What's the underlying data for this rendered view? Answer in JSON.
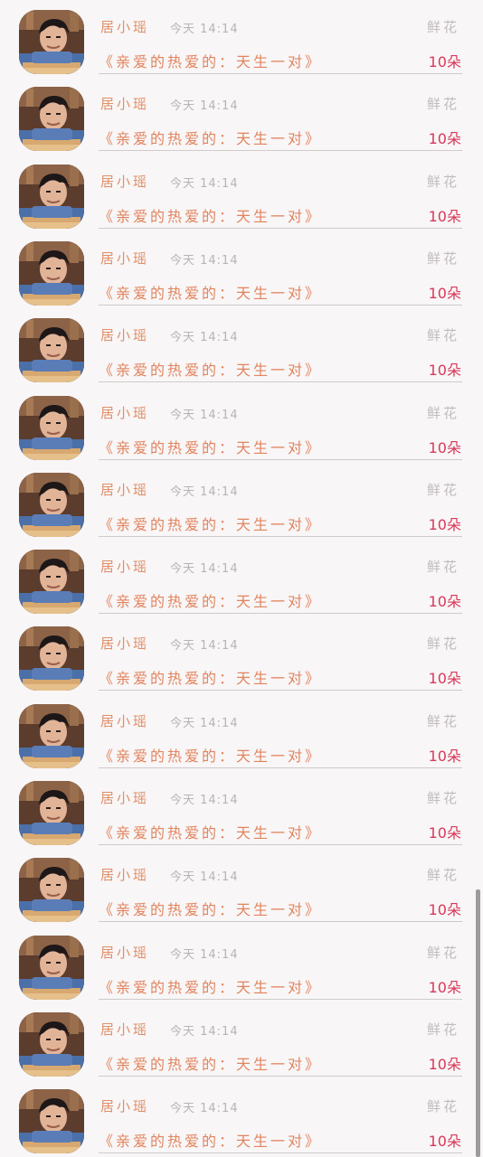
{
  "colors": {
    "background": "#f8f6f7",
    "name": "#e08f68",
    "time": "#b9b4b4",
    "gift": "#c2bcbc",
    "message": "#e2845e",
    "count": "#d8385a",
    "divider": "#cfcbcb"
  },
  "rows": [
    {
      "name": "居小瑶",
      "time": "今天 14:14",
      "gift": "鲜花",
      "message": "《亲爱的热爱的：天生一对》",
      "count": "10朵",
      "avatar": "avatar-photo"
    },
    {
      "name": "居小瑶",
      "time": "今天 14:14",
      "gift": "鲜花",
      "message": "《亲爱的热爱的：天生一对》",
      "count": "10朵",
      "avatar": "avatar-photo"
    },
    {
      "name": "居小瑶",
      "time": "今天 14:14",
      "gift": "鲜花",
      "message": "《亲爱的热爱的：天生一对》",
      "count": "10朵",
      "avatar": "avatar-photo"
    },
    {
      "name": "居小瑶",
      "time": "今天 14:14",
      "gift": "鲜花",
      "message": "《亲爱的热爱的：天生一对》",
      "count": "10朵",
      "avatar": "avatar-photo"
    },
    {
      "name": "居小瑶",
      "time": "今天 14:14",
      "gift": "鲜花",
      "message": "《亲爱的热爱的：天生一对》",
      "count": "10朵",
      "avatar": "avatar-photo"
    },
    {
      "name": "居小瑶",
      "time": "今天 14:14",
      "gift": "鲜花",
      "message": "《亲爱的热爱的：天生一对》",
      "count": "10朵",
      "avatar": "avatar-photo"
    },
    {
      "name": "居小瑶",
      "time": "今天 14:14",
      "gift": "鲜花",
      "message": "《亲爱的热爱的：天生一对》",
      "count": "10朵",
      "avatar": "avatar-photo"
    },
    {
      "name": "居小瑶",
      "time": "今天 14:14",
      "gift": "鲜花",
      "message": "《亲爱的热爱的：天生一对》",
      "count": "10朵",
      "avatar": "avatar-photo"
    },
    {
      "name": "居小瑶",
      "time": "今天 14:14",
      "gift": "鲜花",
      "message": "《亲爱的热爱的：天生一对》",
      "count": "10朵",
      "avatar": "avatar-photo"
    },
    {
      "name": "居小瑶",
      "time": "今天 14:14",
      "gift": "鲜花",
      "message": "《亲爱的热爱的：天生一对》",
      "count": "10朵",
      "avatar": "avatar-photo"
    },
    {
      "name": "居小瑶",
      "time": "今天 14:14",
      "gift": "鲜花",
      "message": "《亲爱的热爱的：天生一对》",
      "count": "10朵",
      "avatar": "avatar-photo"
    },
    {
      "name": "居小瑶",
      "time": "今天 14:14",
      "gift": "鲜花",
      "message": "《亲爱的热爱的：天生一对》",
      "count": "10朵",
      "avatar": "avatar-photo"
    },
    {
      "name": "居小瑶",
      "time": "今天 14:14",
      "gift": "鲜花",
      "message": "《亲爱的热爱的：天生一对》",
      "count": "10朵",
      "avatar": "avatar-photo"
    },
    {
      "name": "居小瑶",
      "time": "今天 14:14",
      "gift": "鲜花",
      "message": "《亲爱的热爱的：天生一对》",
      "count": "10朵",
      "avatar": "avatar-photo"
    },
    {
      "name": "居小瑶",
      "time": "今天 14:14",
      "gift": "鲜花",
      "message": "《亲爱的热爱的：天生一对》",
      "count": "10朵",
      "avatar": "avatar-photo"
    }
  ]
}
